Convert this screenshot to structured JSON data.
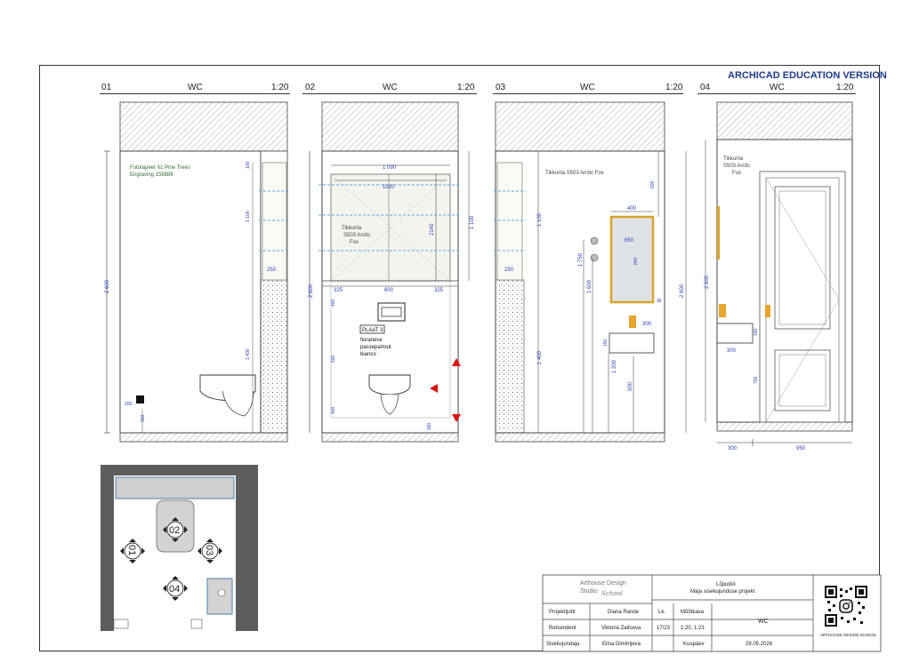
{
  "watermark": "ARCHICAD EDUCATION VERSION",
  "views": [
    {
      "num": "01",
      "name": "WC",
      "scale": "1:20"
    },
    {
      "num": "02",
      "name": "WC",
      "scale": "1:20"
    },
    {
      "num": "03",
      "name": "WC",
      "scale": "1:20"
    },
    {
      "num": "04",
      "name": "WC",
      "scale": "1:20"
    }
  ],
  "notes": {
    "v1_wallpaper": [
      "Fototapeet XL Pine Trees",
      "Engraving 158886"
    ],
    "v2_paint": [
      "Tikkurila",
      "S503 Arctic",
      "Fox"
    ],
    "v2_tile_tag": "PLAAT 3",
    "v2_tile": [
      "fioranese",
      "passepartout",
      "bianco"
    ],
    "v3_paint": "Tikkurila S503 Arctic Fox",
    "v4_paint": [
      "Tikkurila",
      "S503 Arctic",
      "Fox"
    ]
  },
  "dims": {
    "v1": [
      "2 600",
      "100",
      "1 100",
      "250",
      "1 400",
      "200",
      "300"
    ],
    "v2": [
      "1 090",
      "1010",
      "2140",
      "1 100",
      "2 600",
      "325",
      "600",
      "325",
      "400",
      "600",
      "400",
      "180"
    ],
    "v3": [
      "600",
      "400",
      "650",
      "800",
      "1 100",
      "1 750",
      "1 600",
      "1 400",
      "250",
      "300",
      "150",
      "1 200",
      "900",
      "2 600",
      "35"
    ],
    "v4": [
      "2 600",
      "300",
      "150",
      "750",
      "300",
      "950"
    ]
  },
  "plan_markers": [
    "01",
    "02",
    "03",
    "04"
  ],
  "titleblock": {
    "studio": [
      "Arthouse Design",
      "Studio",
      "School"
    ],
    "project_line1": "Lõputöö",
    "project_line2": "Maja sisekujunduse projekt",
    "rows": [
      {
        "role": "Projektijuht",
        "name": "Diana Rande",
        "k1": "Lk.",
        "k2": "Mõõtkava"
      },
      {
        "role": "Retsendent",
        "name": "Viktoria Zaitseva",
        "k1": "17/23",
        "k2": "1:20, 1:23"
      },
      {
        "role": "Sisekujundaja",
        "name": "Elina Dimitrijeva",
        "k1": "",
        "k2": "Kuupäev"
      }
    ],
    "sheet_title": "WC",
    "date": "29.05.2026",
    "qr_caption": "ARTHOUSE DESIGN SCHOOL"
  }
}
